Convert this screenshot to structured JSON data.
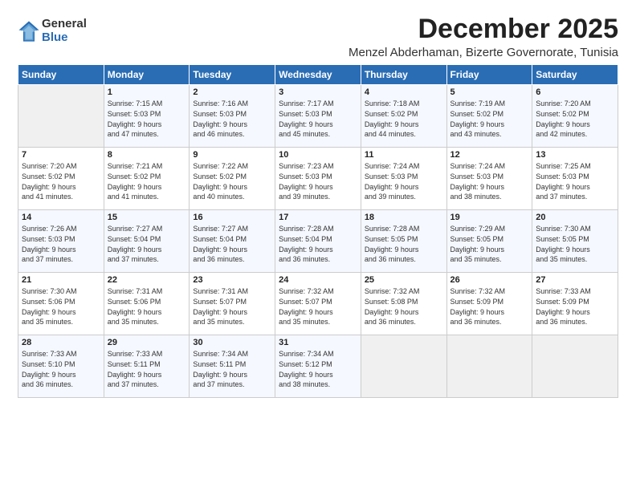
{
  "logo": {
    "general": "General",
    "blue": "Blue"
  },
  "header": {
    "month": "December 2025",
    "location": "Menzel Abderhaman, Bizerte Governorate, Tunisia"
  },
  "weekdays": [
    "Sunday",
    "Monday",
    "Tuesday",
    "Wednesday",
    "Thursday",
    "Friday",
    "Saturday"
  ],
  "weeks": [
    [
      {
        "day": "",
        "info": ""
      },
      {
        "day": "1",
        "info": "Sunrise: 7:15 AM\nSunset: 5:03 PM\nDaylight: 9 hours\nand 47 minutes."
      },
      {
        "day": "2",
        "info": "Sunrise: 7:16 AM\nSunset: 5:03 PM\nDaylight: 9 hours\nand 46 minutes."
      },
      {
        "day": "3",
        "info": "Sunrise: 7:17 AM\nSunset: 5:03 PM\nDaylight: 9 hours\nand 45 minutes."
      },
      {
        "day": "4",
        "info": "Sunrise: 7:18 AM\nSunset: 5:02 PM\nDaylight: 9 hours\nand 44 minutes."
      },
      {
        "day": "5",
        "info": "Sunrise: 7:19 AM\nSunset: 5:02 PM\nDaylight: 9 hours\nand 43 minutes."
      },
      {
        "day": "6",
        "info": "Sunrise: 7:20 AM\nSunset: 5:02 PM\nDaylight: 9 hours\nand 42 minutes."
      }
    ],
    [
      {
        "day": "7",
        "info": "Sunrise: 7:20 AM\nSunset: 5:02 PM\nDaylight: 9 hours\nand 41 minutes."
      },
      {
        "day": "8",
        "info": "Sunrise: 7:21 AM\nSunset: 5:02 PM\nDaylight: 9 hours\nand 41 minutes."
      },
      {
        "day": "9",
        "info": "Sunrise: 7:22 AM\nSunset: 5:02 PM\nDaylight: 9 hours\nand 40 minutes."
      },
      {
        "day": "10",
        "info": "Sunrise: 7:23 AM\nSunset: 5:03 PM\nDaylight: 9 hours\nand 39 minutes."
      },
      {
        "day": "11",
        "info": "Sunrise: 7:24 AM\nSunset: 5:03 PM\nDaylight: 9 hours\nand 39 minutes."
      },
      {
        "day": "12",
        "info": "Sunrise: 7:24 AM\nSunset: 5:03 PM\nDaylight: 9 hours\nand 38 minutes."
      },
      {
        "day": "13",
        "info": "Sunrise: 7:25 AM\nSunset: 5:03 PM\nDaylight: 9 hours\nand 37 minutes."
      }
    ],
    [
      {
        "day": "14",
        "info": "Sunrise: 7:26 AM\nSunset: 5:03 PM\nDaylight: 9 hours\nand 37 minutes."
      },
      {
        "day": "15",
        "info": "Sunrise: 7:27 AM\nSunset: 5:04 PM\nDaylight: 9 hours\nand 37 minutes."
      },
      {
        "day": "16",
        "info": "Sunrise: 7:27 AM\nSunset: 5:04 PM\nDaylight: 9 hours\nand 36 minutes."
      },
      {
        "day": "17",
        "info": "Sunrise: 7:28 AM\nSunset: 5:04 PM\nDaylight: 9 hours\nand 36 minutes."
      },
      {
        "day": "18",
        "info": "Sunrise: 7:28 AM\nSunset: 5:05 PM\nDaylight: 9 hours\nand 36 minutes."
      },
      {
        "day": "19",
        "info": "Sunrise: 7:29 AM\nSunset: 5:05 PM\nDaylight: 9 hours\nand 35 minutes."
      },
      {
        "day": "20",
        "info": "Sunrise: 7:30 AM\nSunset: 5:05 PM\nDaylight: 9 hours\nand 35 minutes."
      }
    ],
    [
      {
        "day": "21",
        "info": "Sunrise: 7:30 AM\nSunset: 5:06 PM\nDaylight: 9 hours\nand 35 minutes."
      },
      {
        "day": "22",
        "info": "Sunrise: 7:31 AM\nSunset: 5:06 PM\nDaylight: 9 hours\nand 35 minutes."
      },
      {
        "day": "23",
        "info": "Sunrise: 7:31 AM\nSunset: 5:07 PM\nDaylight: 9 hours\nand 35 minutes."
      },
      {
        "day": "24",
        "info": "Sunrise: 7:32 AM\nSunset: 5:07 PM\nDaylight: 9 hours\nand 35 minutes."
      },
      {
        "day": "25",
        "info": "Sunrise: 7:32 AM\nSunset: 5:08 PM\nDaylight: 9 hours\nand 36 minutes."
      },
      {
        "day": "26",
        "info": "Sunrise: 7:32 AM\nSunset: 5:09 PM\nDaylight: 9 hours\nand 36 minutes."
      },
      {
        "day": "27",
        "info": "Sunrise: 7:33 AM\nSunset: 5:09 PM\nDaylight: 9 hours\nand 36 minutes."
      }
    ],
    [
      {
        "day": "28",
        "info": "Sunrise: 7:33 AM\nSunset: 5:10 PM\nDaylight: 9 hours\nand 36 minutes."
      },
      {
        "day": "29",
        "info": "Sunrise: 7:33 AM\nSunset: 5:11 PM\nDaylight: 9 hours\nand 37 minutes."
      },
      {
        "day": "30",
        "info": "Sunrise: 7:34 AM\nSunset: 5:11 PM\nDaylight: 9 hours\nand 37 minutes."
      },
      {
        "day": "31",
        "info": "Sunrise: 7:34 AM\nSunset: 5:12 PM\nDaylight: 9 hours\nand 38 minutes."
      },
      {
        "day": "",
        "info": ""
      },
      {
        "day": "",
        "info": ""
      },
      {
        "day": "",
        "info": ""
      }
    ]
  ]
}
